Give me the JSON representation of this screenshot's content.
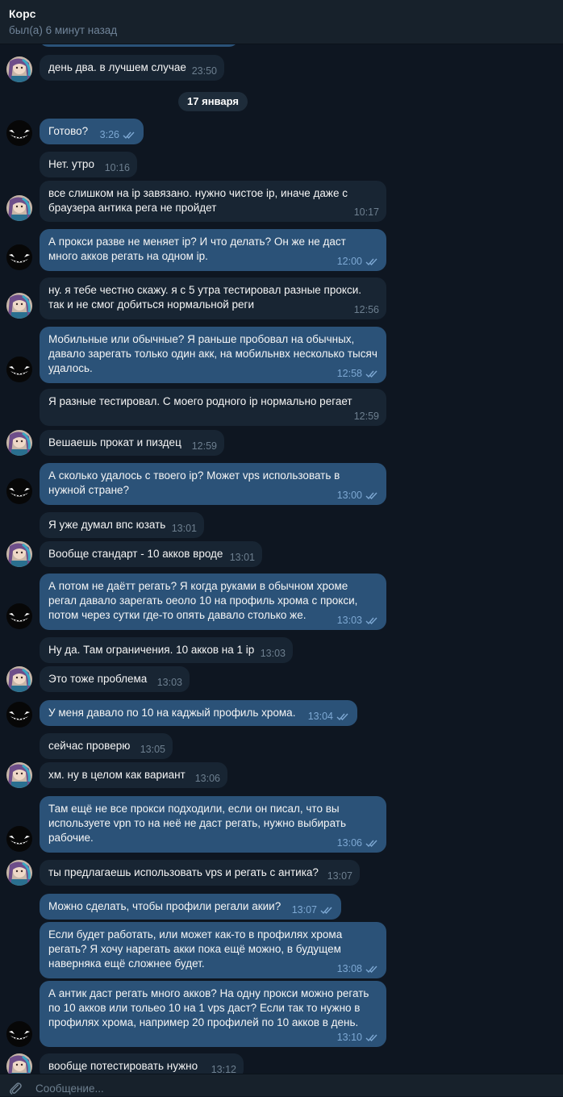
{
  "chat": {
    "name": "Корс",
    "status": "был(а) 6 минут назад"
  },
  "date_separator": "17 января",
  "messages": [
    {
      "dir": "in",
      "text": "день два. в лучшем случае",
      "time": "23:50"
    },
    {
      "dir": "out",
      "text": "Готово?",
      "time": "3:26"
    },
    {
      "dir": "in",
      "text": "Нет. утро",
      "time": "10:16"
    },
    {
      "dir": "in",
      "text": "все слишком на ip завязано. нужно чистое ip, иначе даже с браузера антика рега не пройдет",
      "time": "10:17"
    },
    {
      "dir": "out",
      "text": "А прокси разве не меняет ip? И что делать? Он же не даст много акков регать на одном ip.",
      "time": "12:00"
    },
    {
      "dir": "in",
      "text": "ну. я тебе честно скажу. я с 5 утра тестировал разные прокси. так и не смог добиться нормальной реги",
      "time": "12:56"
    },
    {
      "dir": "out",
      "text": "Мобильные или обычные? Я раньше пробовал на обычных, давало зарегать только один акк, на мобильнвх несколько тысяч удалось.",
      "time": "12:58"
    },
    {
      "dir": "in",
      "text": "Я разные тестировал. С моего родного ip нормально регает",
      "time": "12:59"
    },
    {
      "dir": "in",
      "text": "Вешаешь прокат и пиздец",
      "time": "12:59"
    },
    {
      "dir": "out",
      "text": "А сколько удалось с твоего ip? Может vps использовать в нужной стране?",
      "time": "13:00"
    },
    {
      "dir": "in",
      "text": "Я уже думал впс юзать",
      "time": "13:01"
    },
    {
      "dir": "in",
      "text": "Вообще стандарт - 10 акков вроде",
      "time": "13:01"
    },
    {
      "dir": "out",
      "text": "А потом не даётт регать? Я когда руками в обычном хроме регал давало зарегать оеоло 10 на профиль хрома с прокси, потом через сутки где-то опять давало столько же.",
      "time": "13:03"
    },
    {
      "dir": "in",
      "text": "Ну да. Там ограничения. 10 акков на 1 ip",
      "time": "13:03"
    },
    {
      "dir": "in",
      "text": "Это тоже проблема",
      "time": "13:03"
    },
    {
      "dir": "out",
      "text": "У меня давало по 10 на каджый профиль хрома.",
      "time": "13:04"
    },
    {
      "dir": "in",
      "text": "сейчас проверю",
      "time": "13:05"
    },
    {
      "dir": "in",
      "text": "хм. ну в целом как вариант",
      "time": "13:06"
    },
    {
      "dir": "out",
      "text": "Там ещё не все прокси подходили, если он писал, что вы используете vpn то на неё не даст регать, нужно выбирать рабочие.",
      "time": "13:06"
    },
    {
      "dir": "in",
      "text": "ты предлагаешь использовать vps и регать с антика?",
      "time": "13:07"
    },
    {
      "dir": "out",
      "text": "Можно сделать, чтобы профили регали акии?",
      "time": "13:07"
    },
    {
      "dir": "out",
      "text": "Если будет работать, или может как-то в профилях хрома регать? Я хочу нарегать акки пока ещё можно, в будущем наверняка ещё сложнее будет.",
      "time": "13:08"
    },
    {
      "dir": "out",
      "text": "А антик даст регать много акков? На одну прокси можно регать по 10 акков или тольео 10 на 1 vps даст? Если так то нужно в профилях хрома, например 20 профилей по 10 акков в день.",
      "time": "13:10"
    },
    {
      "dir": "in",
      "text": "вообще потестировать нужно",
      "time": "13:12"
    }
  ],
  "composer": {
    "placeholder": "Сообщение..."
  },
  "icons": {
    "attach": "paperclip-icon",
    "read_receipt": "double-check-icon"
  },
  "colors": {
    "background": "#0e1621",
    "header": "#17212b",
    "incoming_bubble": "#182533",
    "outgoing_bubble": "#2b5278",
    "time_in": "#6d7f8f",
    "time_out": "#7da8d3"
  }
}
